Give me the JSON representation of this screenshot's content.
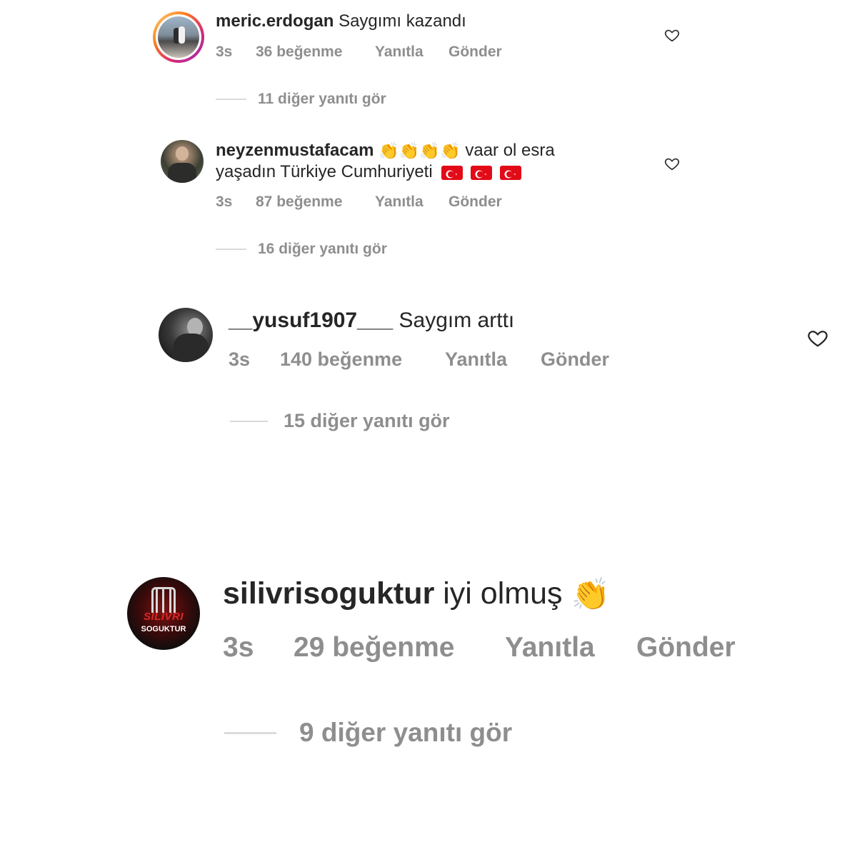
{
  "comments": [
    {
      "username": "meric.erdogan",
      "text": "Saygımı kazandı",
      "time": "3s",
      "likes": "36 beğenme",
      "reply": "Yanıtla",
      "send": "Gönder",
      "view_replies": "11 diğer yanıtı gör"
    },
    {
      "username": "neyzenmustafacam",
      "text_line1": "vaar ol esra",
      "text_line2": "yaşadın Türkiye Cumhuriyeti",
      "time": "3s",
      "likes": "87 beğenme",
      "reply": "Yanıtla",
      "send": "Gönder",
      "view_replies": "16 diğer yanıtı gör"
    },
    {
      "username": "__yusuf1907___",
      "text": "Saygım arttı",
      "time": "3s",
      "likes": "140 beğenme",
      "reply": "Yanıtla",
      "send": "Gönder",
      "view_replies": "15 diğer yanıtı gör"
    },
    {
      "username": "silivrisoguktur",
      "text": "iyi olmuş",
      "avatar_text_top": "SILIVRI",
      "avatar_text_bottom": "SOGUKTUR",
      "time": "3s",
      "likes": "29 beğenme",
      "reply": "Yanıtla",
      "send": "Gönder",
      "view_replies": "9 diğer yanıtı gör"
    }
  ],
  "icons": {
    "like": "heart-outline-icon",
    "clap": "clapping-hands-emoji",
    "flag": "turkey-flag-emoji"
  },
  "colors": {
    "text": "#262626",
    "secondary": "#8e8e8e",
    "divider": "#dbdbdb",
    "story_ring_start": "#feda75",
    "story_ring_end": "#d62976"
  }
}
